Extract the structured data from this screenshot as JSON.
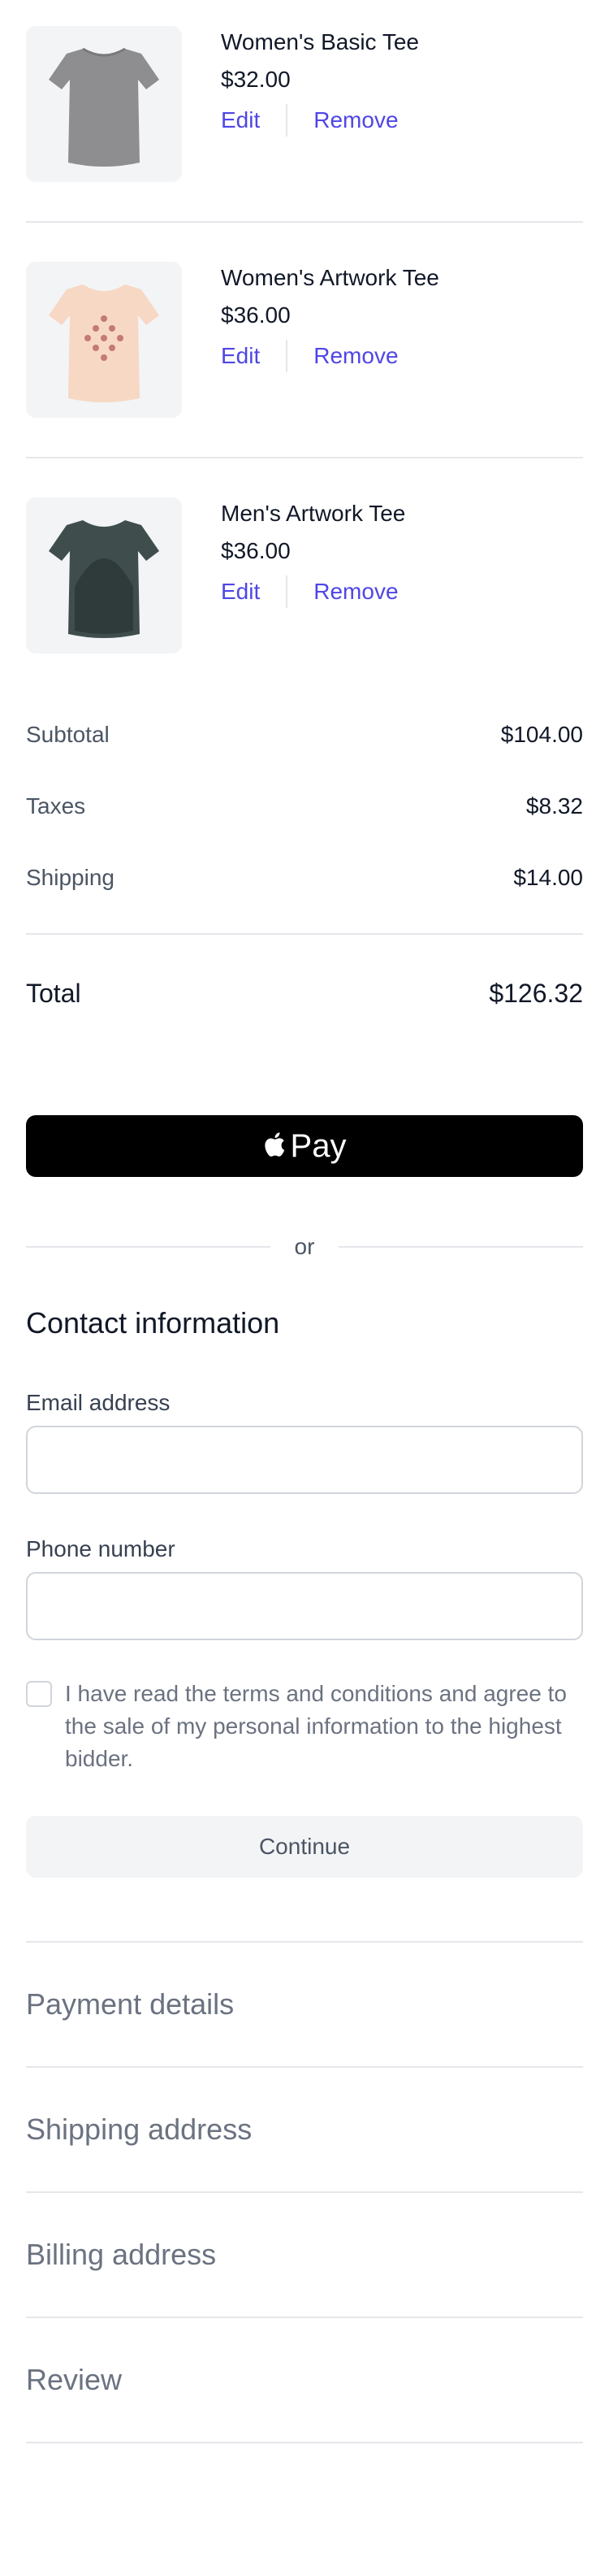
{
  "cart": {
    "items": [
      {
        "name": "Women's Basic Tee",
        "price": "$32.00",
        "edit": "Edit",
        "remove": "Remove"
      },
      {
        "name": "Women's Artwork Tee",
        "price": "$36.00",
        "edit": "Edit",
        "remove": "Remove"
      },
      {
        "name": "Men's Artwork Tee",
        "price": "$36.00",
        "edit": "Edit",
        "remove": "Remove"
      }
    ]
  },
  "summary": {
    "subtotal_label": "Subtotal",
    "subtotal_value": "$104.00",
    "taxes_label": "Taxes",
    "taxes_value": "$8.32",
    "shipping_label": "Shipping",
    "shipping_value": "$14.00",
    "total_label": "Total",
    "total_value": "$126.32"
  },
  "pay": {
    "apple_pay_label": "Pay",
    "divider": "or"
  },
  "contact": {
    "title": "Contact information",
    "email_label": "Email address",
    "email_value": "",
    "phone_label": "Phone number",
    "phone_value": "",
    "terms": "I have read the terms and conditions and agree to the sale of my personal information to the highest bidder.",
    "terms_checked": false,
    "continue": "Continue"
  },
  "steps": [
    "Payment details",
    "Shipping address",
    "Billing address",
    "Review"
  ],
  "colors": {
    "accent": "#4f46e5",
    "muted": "#6b7280",
    "border": "#e5e7eb"
  },
  "icons": {
    "apple": "apple-icon"
  }
}
